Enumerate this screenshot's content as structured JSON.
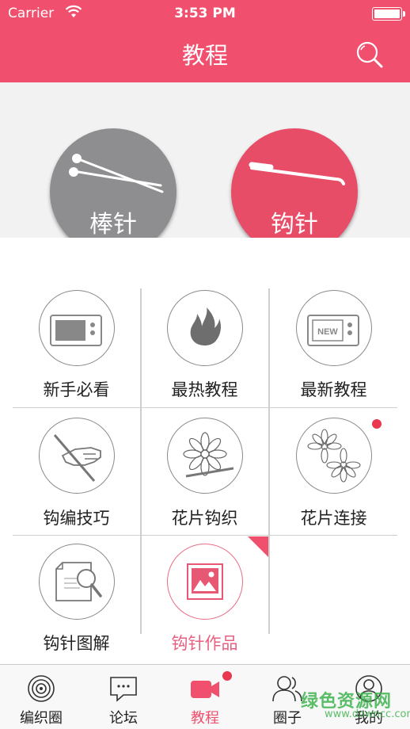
{
  "status_bar": {
    "carrier": "Carrier",
    "time": "3:53 PM"
  },
  "header": {
    "title": "教程"
  },
  "hero": {
    "knitting_label": "棒针",
    "crochet_label": "钩针"
  },
  "grid": {
    "items": [
      {
        "label": "新手必看",
        "icon": "tv-icon"
      },
      {
        "label": "最热教程",
        "icon": "flame-icon"
      },
      {
        "label": "最新教程",
        "icon": "new-tv-icon",
        "tv_text": "NEW"
      },
      {
        "label": "钩编技巧",
        "icon": "hand-hook-icon"
      },
      {
        "label": "花片钩织",
        "icon": "flower-icon"
      },
      {
        "label": "花片连接",
        "icon": "two-flowers-icon",
        "badge": true
      },
      {
        "label": "钩针图解",
        "icon": "diagram-magnifier-icon"
      },
      {
        "label": "钩针作品",
        "icon": "picture-icon",
        "selected": true
      }
    ]
  },
  "tabbar": {
    "items": [
      {
        "label": "编织圈",
        "icon": "target-icon"
      },
      {
        "label": "论坛",
        "icon": "chat-icon"
      },
      {
        "label": "教程",
        "icon": "video-camera-icon",
        "active": true,
        "badge": true
      },
      {
        "label": "圈子",
        "icon": "people-icon"
      },
      {
        "label": "我的",
        "icon": "person-icon"
      }
    ]
  },
  "watermark": {
    "text": "绿色资源网",
    "sub": "www.downcc.com"
  },
  "colors": {
    "brand": "#f0506e",
    "knit_gray": "#8e8e90",
    "crochet_pink": "#e84d68",
    "badge_red": "#e8374e"
  }
}
